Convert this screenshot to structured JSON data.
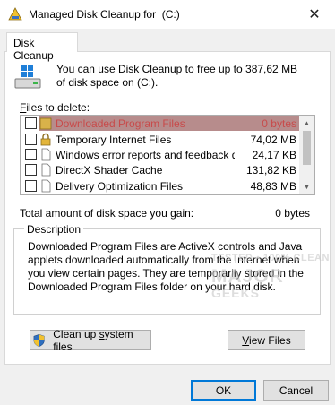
{
  "window": {
    "title": "Managed Disk Cleanup for  (C:)",
    "close_glyph": "✕"
  },
  "tab": {
    "label": "Disk Cleanup"
  },
  "intro_text": "You can use Disk Cleanup to free up to 387,62 MB of disk space on  (C:).",
  "files_label": {
    "accel": "F",
    "rest": "iles to delete:"
  },
  "files": [
    {
      "name": "Downloaded Program Files",
      "size": "0 bytes",
      "checked": false,
      "selected": true,
      "icon": "folder-icon"
    },
    {
      "name": "Temporary Internet Files",
      "size": "74,02 MB",
      "checked": false,
      "selected": false,
      "icon": "lock-icon"
    },
    {
      "name": "Windows error reports and feedback d...",
      "size": "24,17 KB",
      "checked": false,
      "selected": false,
      "icon": "document-icon"
    },
    {
      "name": "DirectX Shader Cache",
      "size": "131,82 KB",
      "checked": false,
      "selected": false,
      "icon": "document-icon"
    },
    {
      "name": "Delivery Optimization Files",
      "size": "48,83 MB",
      "checked": false,
      "selected": false,
      "icon": "document-icon"
    }
  ],
  "total": {
    "label": "Total amount of disk space you gain:",
    "value": "0 bytes"
  },
  "description": {
    "title": "Description",
    "text": "Downloaded Program Files are ActiveX controls and Java applets downloaded automatically from the Internet when you view certain pages. They are temporarily stored in the Downloaded Program Files folder on your hard disk."
  },
  "buttons": {
    "cleanup_system": {
      "pre": "Clean up ",
      "accel": "s",
      "post": "ystem files"
    },
    "view_files": {
      "accel": "V",
      "rest": "iew Files"
    },
    "ok": "OK",
    "cancel": "Cancel"
  },
  "watermark": {
    "line1": "TESTED • 100% CLEAN",
    "line2": "MAJOR",
    "line3": "GEEKS"
  },
  "colors": {
    "accent": "#0078d7",
    "selected_row": "#7b2e2e",
    "window_bg": "#f0f0f0"
  }
}
